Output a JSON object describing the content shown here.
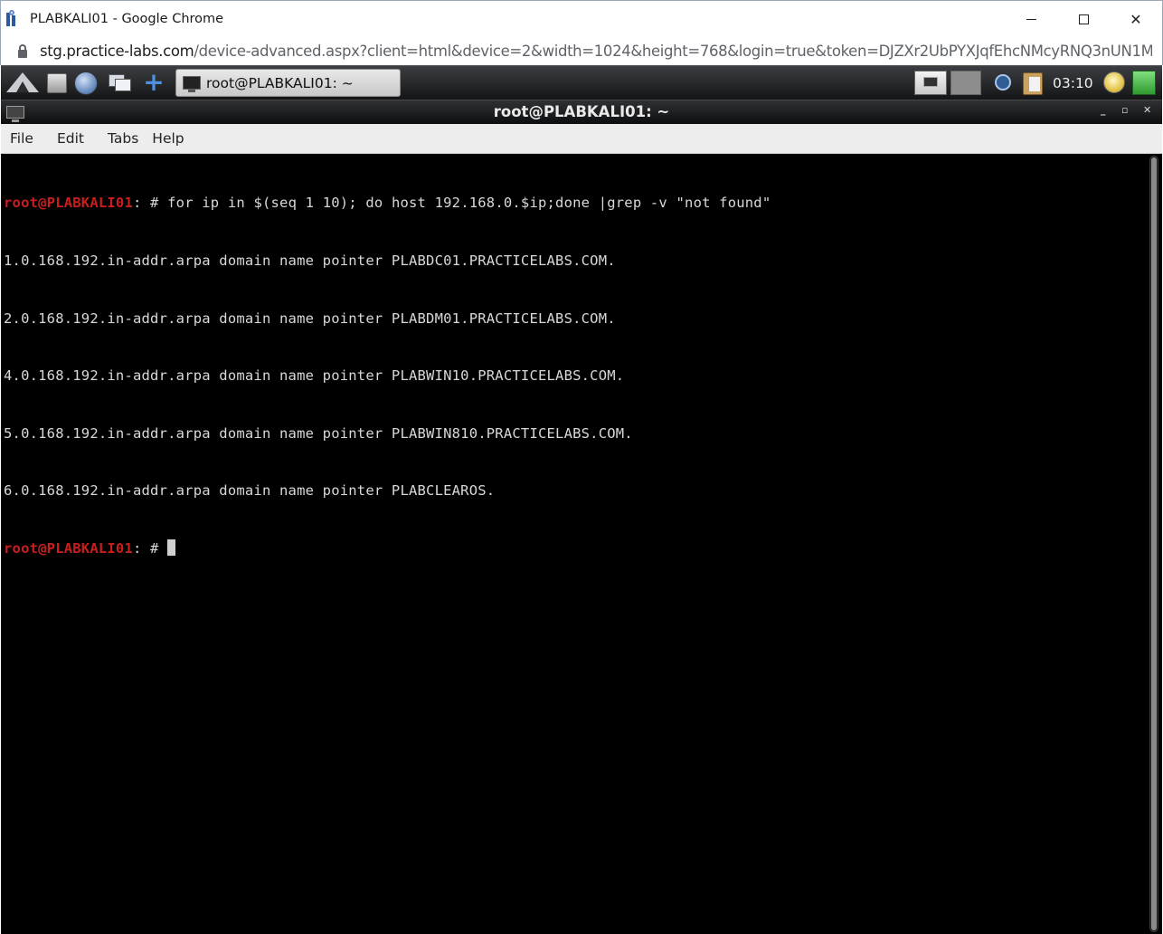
{
  "browser": {
    "window_title": "PLABKALI01 - Google Chrome",
    "url_host": "stg.practice-labs.com",
    "url_path": "/device-advanced.aspx?client=html&device=2&width=1024&height=768&login=true&token=DJZXr2UbPYXJqfEhcNMcyRNQ3nUN1M..."
  },
  "taskbar": {
    "task_label": "root@PLABKALI01: ~",
    "clock": "03:10"
  },
  "terminal": {
    "title": "root@PLABKALI01: ~",
    "menu": [
      "File",
      "Edit",
      "Tabs",
      "Help"
    ],
    "prompt": "root@PLABKALI01",
    "prompt_suffix": ": # ",
    "command": "for ip in $(seq 1 10); do host 192.168.0.$ip;done |grep -v \"not found\"",
    "output": [
      "1.0.168.192.in-addr.arpa domain name pointer PLABDC01.PRACTICELABS.COM.",
      "2.0.168.192.in-addr.arpa domain name pointer PLABDM01.PRACTICELABS.COM.",
      "4.0.168.192.in-addr.arpa domain name pointer PLABWIN10.PRACTICELABS.COM.",
      "5.0.168.192.in-addr.arpa domain name pointer PLABWIN810.PRACTICELABS.COM.",
      "6.0.168.192.in-addr.arpa domain name pointer PLABCLEAROS."
    ]
  },
  "colors": {
    "prompt": "#c81e1e",
    "terminal_bg": "#000000",
    "terminal_fg": "#d8d8d8"
  }
}
